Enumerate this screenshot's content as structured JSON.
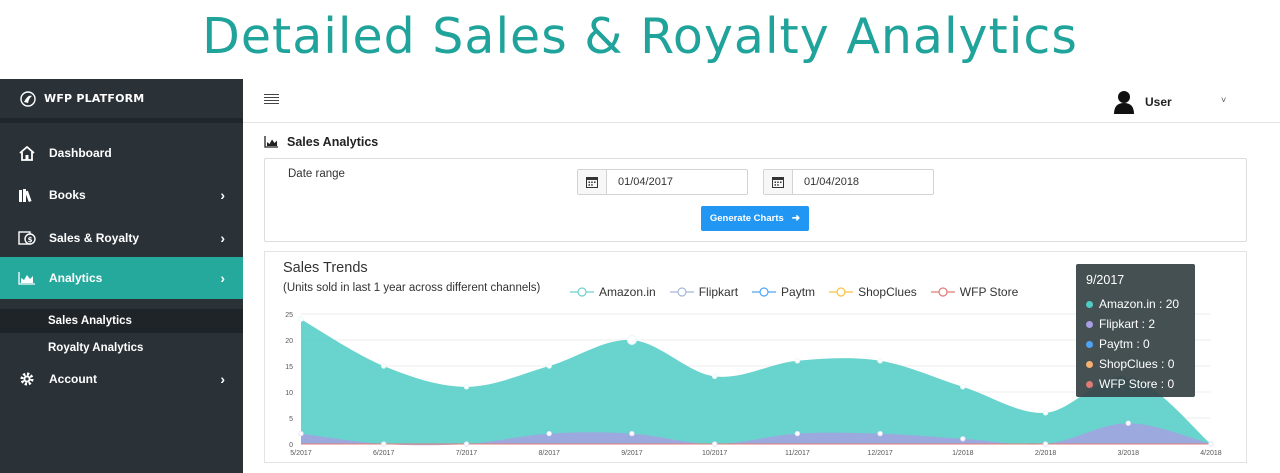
{
  "page_title": "Detailed Sales & Royalty Analytics",
  "sidebar": {
    "brand": "WFP PLATFORM",
    "items": [
      {
        "label": "Dashboard",
        "icon": "home-icon"
      },
      {
        "label": "Books",
        "icon": "books-icon"
      },
      {
        "label": "Sales & Royalty",
        "icon": "money-icon"
      },
      {
        "label": "Analytics",
        "icon": "area-chart-icon"
      },
      {
        "label": "Account",
        "icon": "gear-icon"
      }
    ],
    "sub_items": [
      {
        "label": "Sales Analytics"
      },
      {
        "label": "Royalty Analytics"
      }
    ]
  },
  "topbar": {
    "user_label": "User"
  },
  "section": {
    "title": "Sales Analytics"
  },
  "filters": {
    "date_range_label": "Date range",
    "start_date": "01/04/2017",
    "end_date": "01/04/2018",
    "generate_label": "Generate Charts"
  },
  "tooltip": {
    "title": "9/2017",
    "rows": [
      {
        "text": "Amazon.in : 20",
        "color": "#4ecdc4"
      },
      {
        "text": "Flipkart : 2",
        "color": "#a99de3"
      },
      {
        "text": "Paytm : 0",
        "color": "#4fa3f7"
      },
      {
        "text": "ShopClues : 0",
        "color": "#f5b072"
      },
      {
        "text": "WFP Store : 0",
        "color": "#e07b74"
      }
    ]
  },
  "colors": {
    "accent": "#20a39a",
    "sidebar_bg": "#2a3137",
    "button": "#2196f3"
  },
  "chart_data": {
    "type": "area",
    "title": "Sales Trends",
    "subtitle": "(Units sold in last 1 year across different channels)",
    "categories": [
      "5/2017",
      "6/2017",
      "7/2017",
      "8/2017",
      "9/2017",
      "10/2017",
      "11/2017",
      "12/2017",
      "1/2018",
      "2/2018",
      "3/2018",
      "4/2018"
    ],
    "yticks": [
      0,
      5,
      10,
      15,
      20,
      25
    ],
    "ylim": [
      0,
      25
    ],
    "grid": true,
    "legend_position": "top",
    "series": [
      {
        "name": "Amazon.in",
        "values": [
          24,
          15,
          11,
          15,
          20,
          13,
          16,
          16,
          11,
          6,
          13,
          0
        ],
        "color": "#4ecdc4"
      },
      {
        "name": "Flipkart",
        "values": [
          2,
          0,
          0,
          2,
          2,
          0,
          2,
          2,
          1,
          0,
          4,
          0
        ],
        "color": "#a99de3"
      },
      {
        "name": "Paytm",
        "values": [
          0,
          0,
          0,
          0,
          0,
          0,
          0,
          0,
          0,
          0,
          0,
          0
        ],
        "color": "#4fa3f7"
      },
      {
        "name": "ShopClues",
        "values": [
          0,
          0,
          0,
          0,
          0,
          0,
          0,
          0,
          0,
          0,
          0,
          0
        ],
        "color": "#f5b072"
      },
      {
        "name": "WFP Store",
        "values": [
          0,
          0,
          0,
          0,
          0,
          0,
          0,
          0,
          0,
          0,
          0,
          0
        ],
        "color": "#e07b74"
      }
    ]
  }
}
